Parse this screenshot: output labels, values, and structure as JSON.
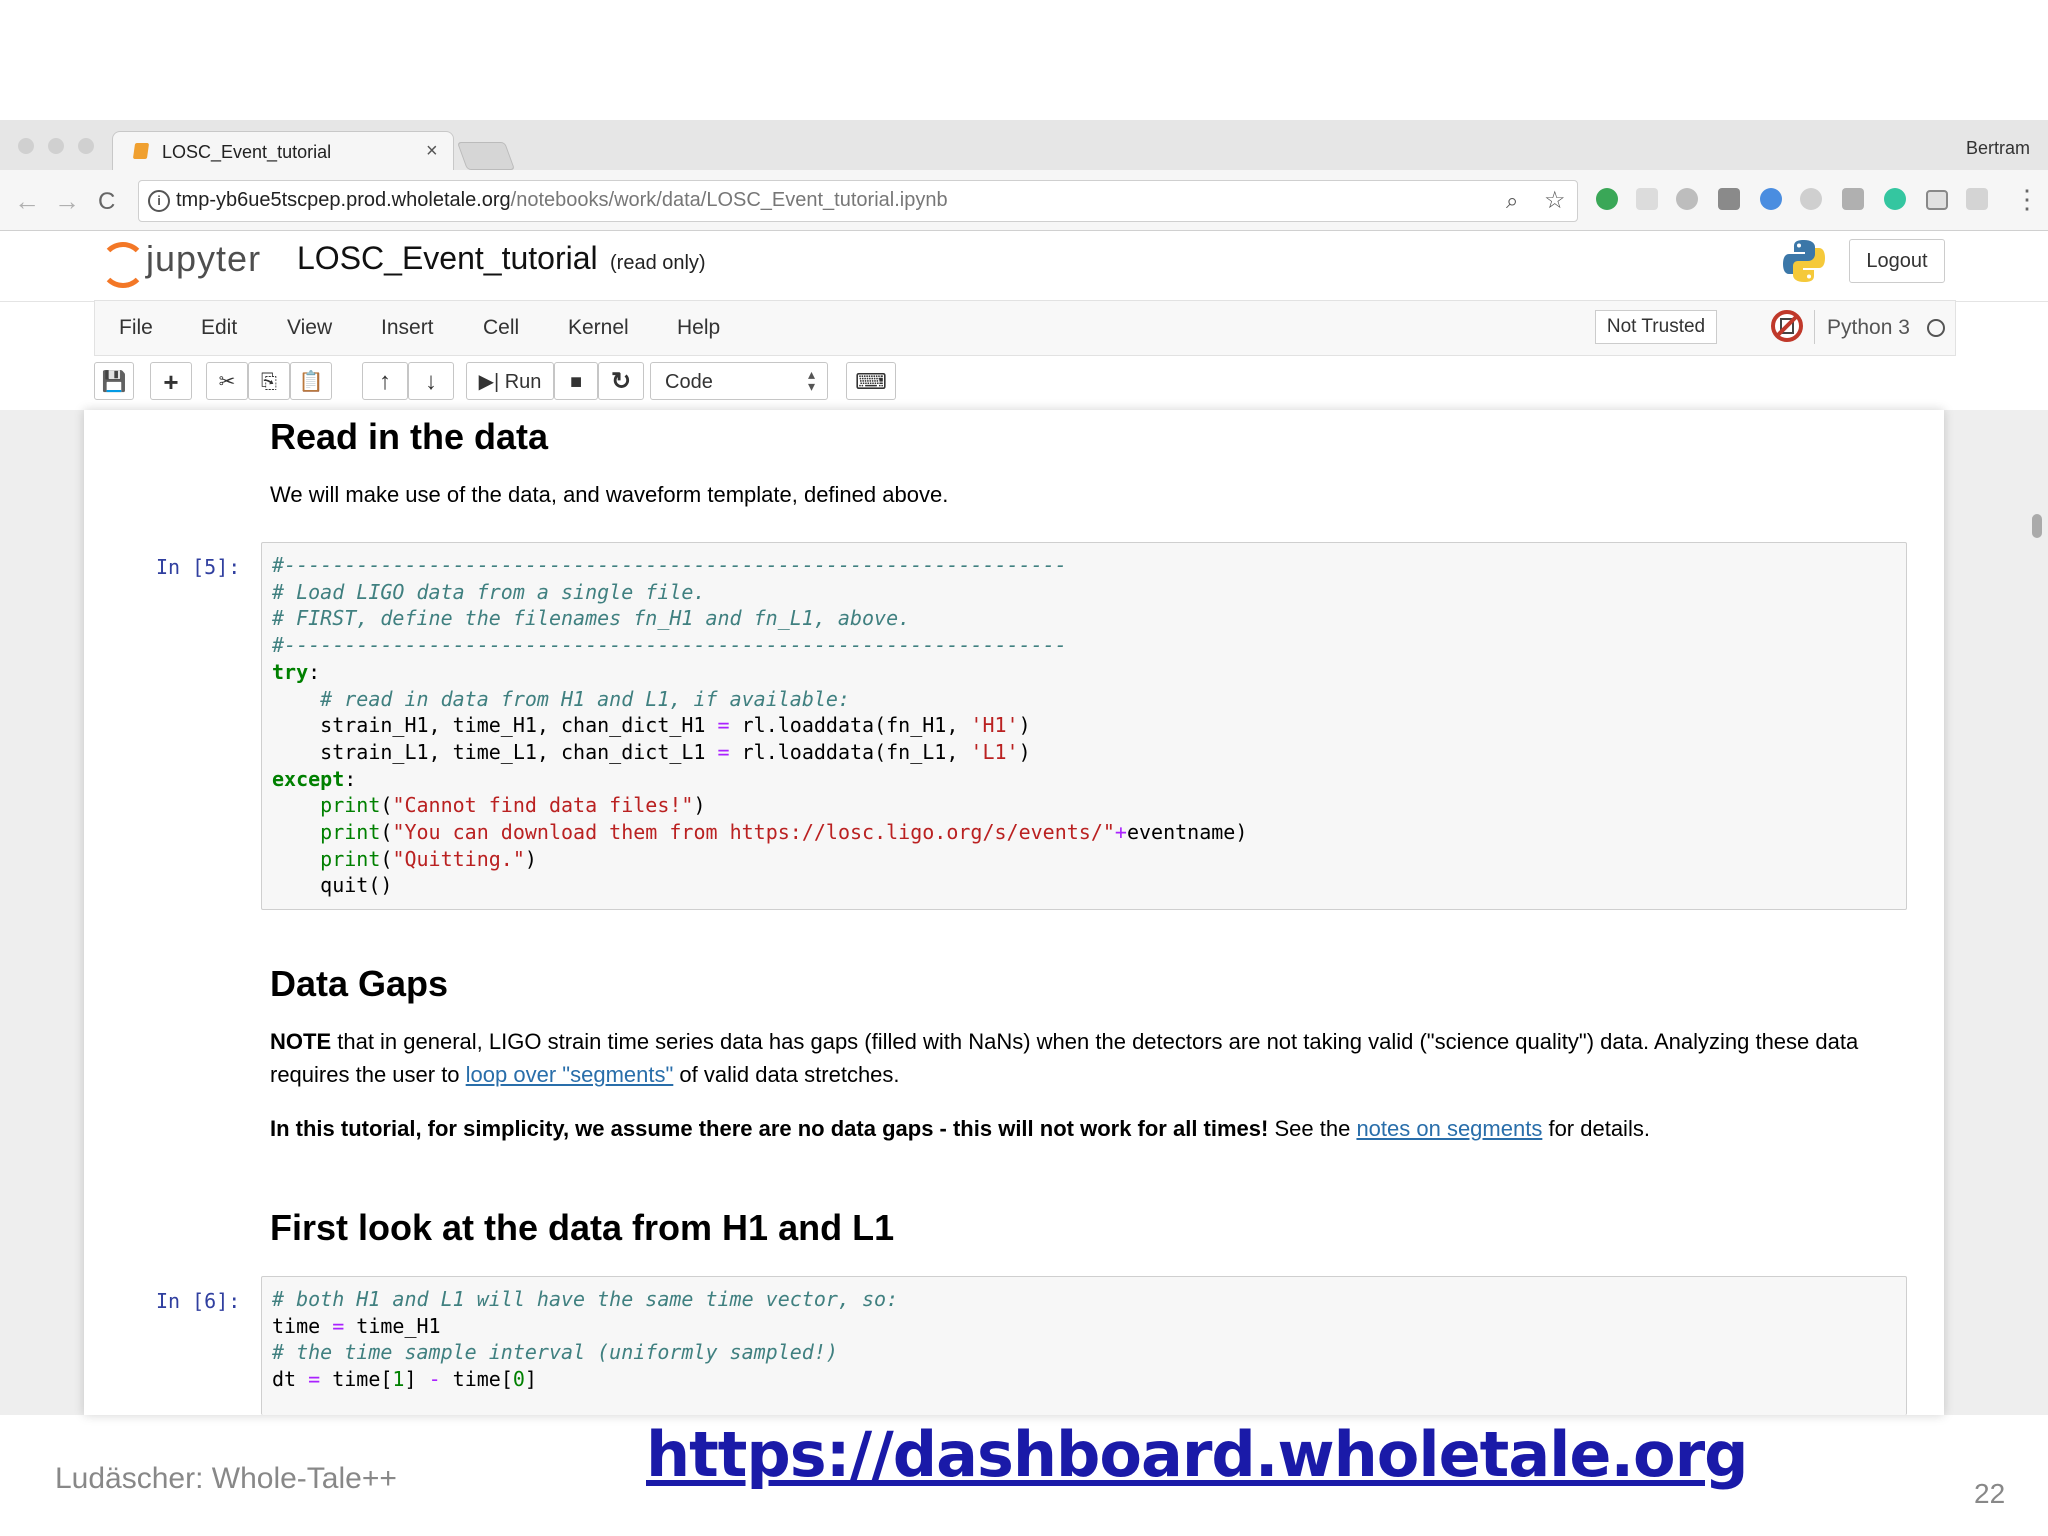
{
  "browser": {
    "tab_title": "LOSC_Event_tutorial",
    "tab_close": "×",
    "user": "Bertram",
    "url_host": "tmp-yb6ue5tscpep.prod.wholetale.org",
    "url_path": "/notebooks/work/data/LOSC_Event_tutorial.ipynb",
    "back_icon": "←",
    "forward_icon": "→",
    "reload_icon": "C",
    "info_icon": "i",
    "zoom_icon": "⌕",
    "star_icon": "☆",
    "menu_icon": "⋮"
  },
  "jupyter": {
    "logo_text": "jupyter",
    "notebook_name": "LOSC_Event_tutorial",
    "status": "(read only)",
    "logout_label": "Logout",
    "menu": [
      "File",
      "Edit",
      "View",
      "Insert",
      "Cell",
      "Kernel",
      "Help"
    ],
    "trust_label": "Not Trusted",
    "kernel_name": "Python 3",
    "toolbar": {
      "save_icon": "💾",
      "add_icon": "+",
      "cut_icon": "✂",
      "copy_icon": "⎘",
      "paste_icon": "📋",
      "up_icon": "↑",
      "down_icon": "↓",
      "run_label": "▶| Run",
      "stop_icon": "■",
      "restart_icon": "↻",
      "cell_type": "Code",
      "keyboard_icon": "⌨"
    }
  },
  "notebook": {
    "sec1_title": "Read in the data",
    "sec1_text": "We will make use of the data, and waveform template, defined above.",
    "cell5_prompt": "In [5]:",
    "sec2_title": "Data Gaps",
    "sec2_p1_bold": "NOTE",
    "sec2_p1_a": " that in general, LIGO strain time series data has gaps (filled with NaNs) when the detectors are not taking valid (\"science quality\") data. Analyzing these data requires the user to ",
    "sec2_p1_link": "loop over \"segments\"",
    "sec2_p1_b": " of valid data stretches.",
    "sec2_p2_bold": "In this tutorial, for simplicity, we assume there are no data gaps - this will not work for all times!",
    "sec2_p2_a": " See the ",
    "sec2_p2_link": "notes on segments",
    "sec2_p2_b": " for details.",
    "sec3_title": "First look at the data from H1 and L1",
    "cell6_prompt": "In [6]:"
  },
  "slide": {
    "url": "https://dashboard.wholetale.org",
    "author": "Ludäscher: Whole-Tale++",
    "page": "22"
  },
  "colors": {
    "jupyter_orange": "#f37726",
    "link_blue": "#296eaa",
    "prompt_blue": "#303f9f",
    "slide_url_blue": "#1a1aa8"
  }
}
